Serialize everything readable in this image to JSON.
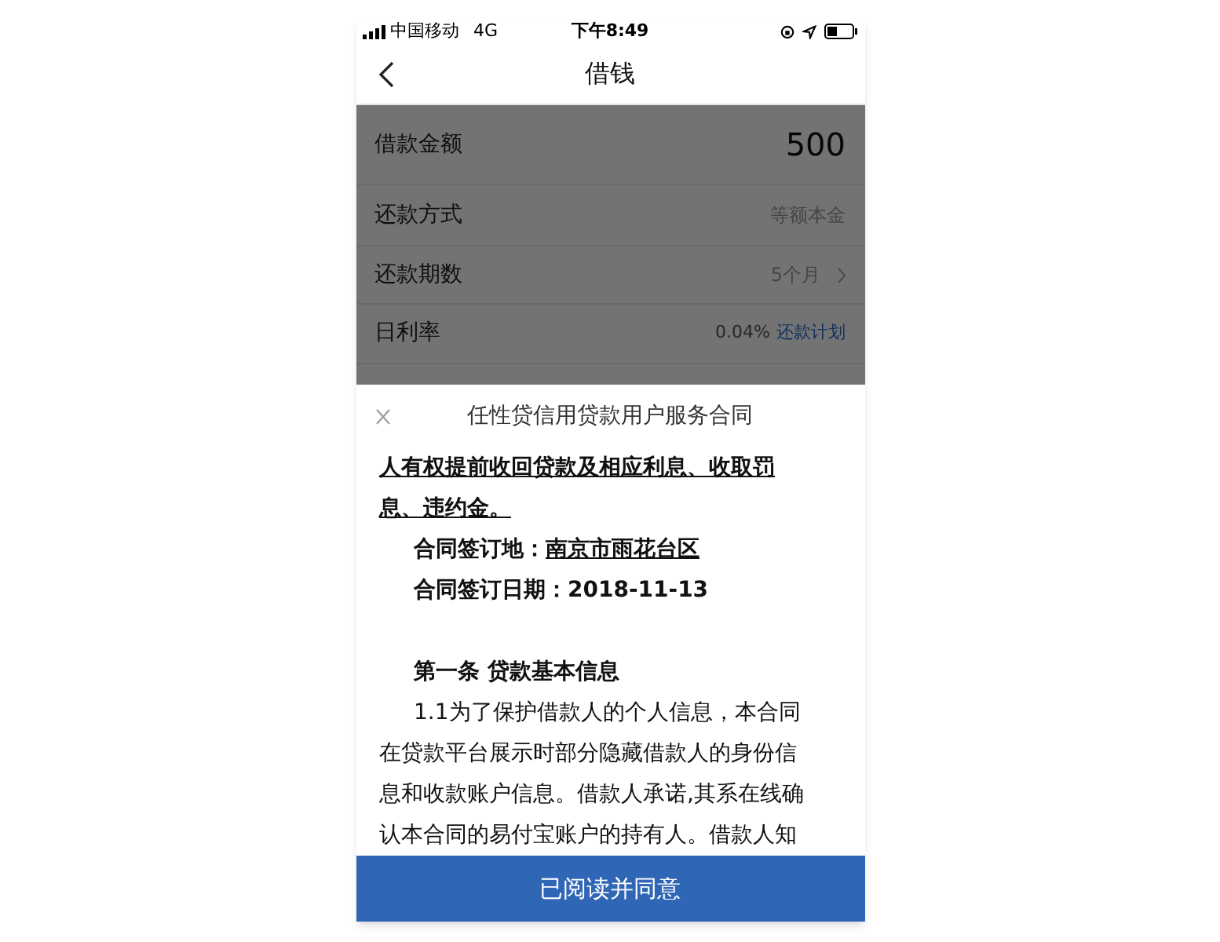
{
  "status_bar": {
    "carrier": "中国移动",
    "network": "4G",
    "time": "下午8:49"
  },
  "nav": {
    "title": "借钱"
  },
  "form": {
    "rows": [
      {
        "kind": "amount",
        "label": "借款金额",
        "value": "500"
      },
      {
        "kind": "plain",
        "label": "还款方式",
        "value": "等额本金"
      },
      {
        "kind": "chevron",
        "label": "还款期数",
        "value": "5个月"
      },
      {
        "kind": "link",
        "label": "日利率",
        "value": "0.04%",
        "link": "还款计划"
      }
    ]
  },
  "sheet": {
    "title": "任性贷信用贷款用户服务合同",
    "blocks": [
      {
        "kind": "underlined",
        "lines": [
          "人有权提前收回贷款及相应利息、收取罚",
          "息、违约金。"
        ]
      },
      {
        "kind": "field",
        "label": "合同签订地：",
        "value": "南京市雨花台区",
        "underline": true
      },
      {
        "kind": "field",
        "label": "合同签订日期：",
        "value": "2018-11-13",
        "underline": false
      },
      {
        "kind": "spacer"
      },
      {
        "kind": "heading",
        "text": "第一条 贷款基本信息"
      },
      {
        "kind": "paragraph",
        "lines": [
          "1.1为了保护借款人的个人信息，本合同",
          "在贷款平台展示时部分隐藏借款人的身份信",
          "息和收款账户信息。借款人承诺,其系在线确",
          "认本合同的易付宝账户的持有人。借款人知"
        ]
      }
    ],
    "button": "已阅读并同意"
  }
}
